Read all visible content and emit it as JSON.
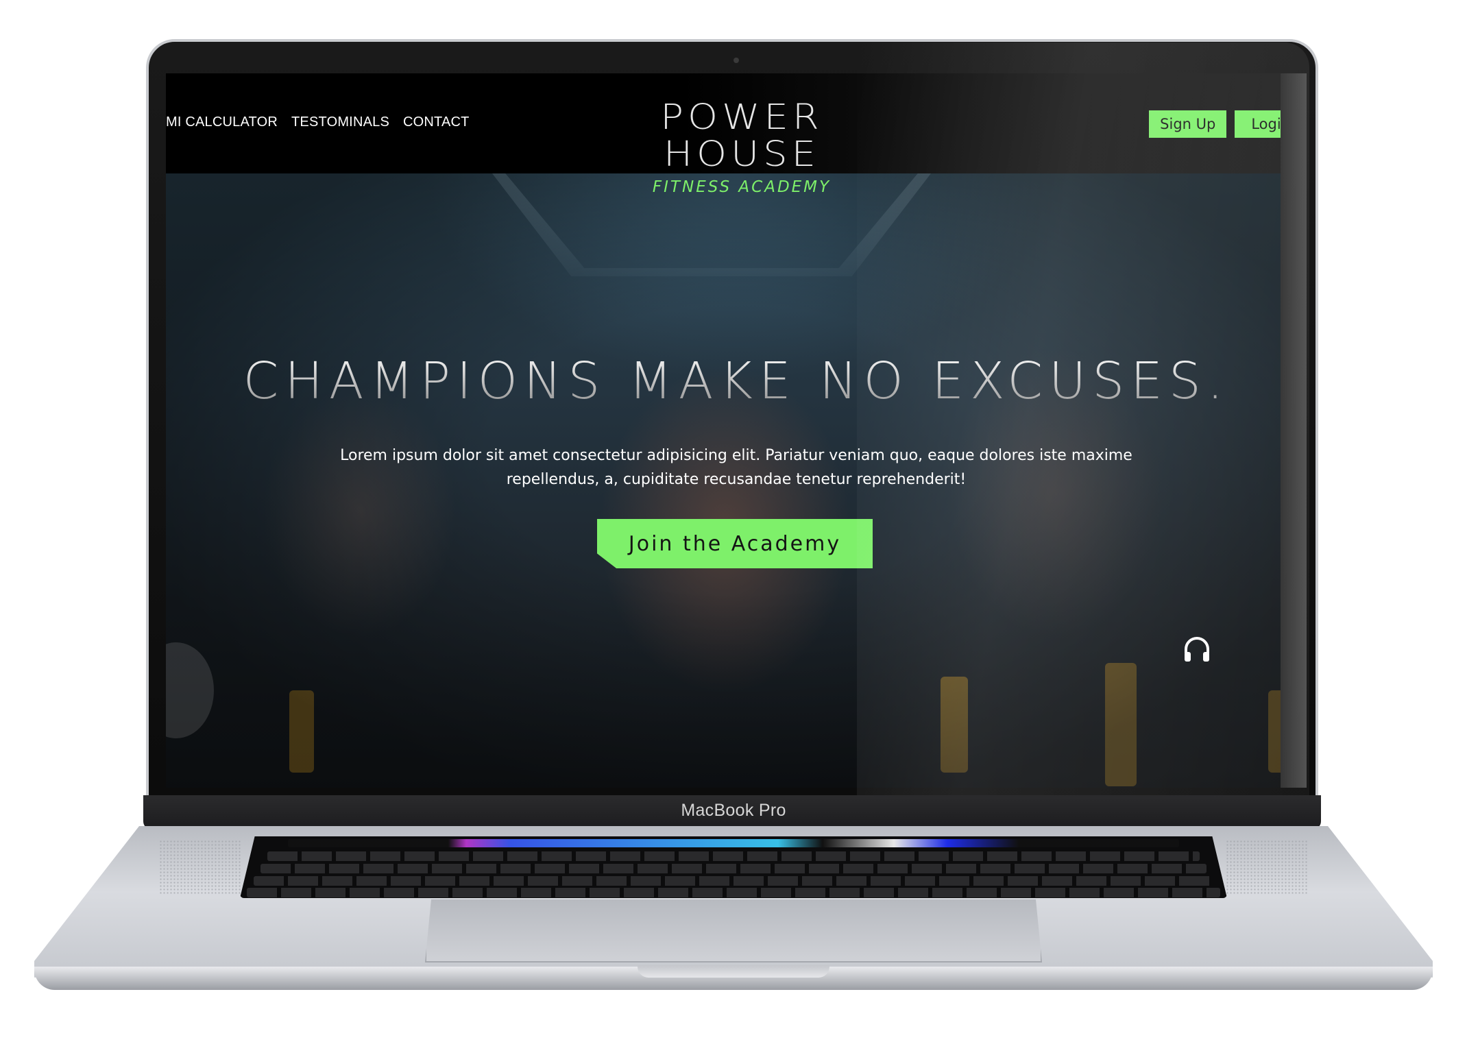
{
  "nav": {
    "links": [
      "MI CALCULATOR",
      "TESTOMINALS",
      "CONTACT"
    ]
  },
  "logo": {
    "title": "POWER HOUSE",
    "subtitle": "FITNESS ACADEMY"
  },
  "auth": {
    "signup": "Sign Up",
    "login": "Login"
  },
  "hero": {
    "headline": "CHAMPIONS MAKE NO EXCUSES.",
    "lead": "Lorem ipsum dolor sit amet consectetur adipisicing elit. Pariatur veniam quo, eaque dolores iste maxime repellendus, a, cupiditate recusandae tenetur reprehenderit!",
    "cta": "Join the Academy",
    "audio_icon": "headphones-icon"
  },
  "device": {
    "model": "MacBook Pro"
  },
  "colors": {
    "accent": "#7ef06a",
    "nav_bg": "#000000"
  }
}
